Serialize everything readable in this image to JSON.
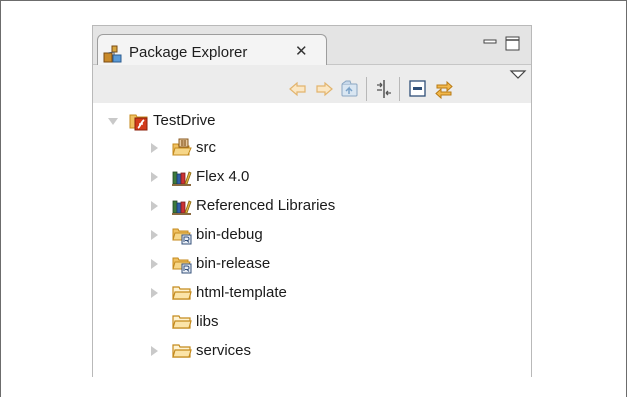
{
  "view": {
    "title": "Package Explorer",
    "close_glyph": "✕",
    "icon": "package-explorer-icon"
  },
  "toolbar": {
    "buttons": [
      "back-icon",
      "forward-icon",
      "up-icon",
      "collapse-all-icon",
      "focus-icon",
      "link-with-editor-icon",
      "view-menu-icon"
    ]
  },
  "tree": {
    "project": {
      "label": "TestDrive",
      "icon": "flex-project-icon",
      "expanded": true
    },
    "items": [
      {
        "label": "src",
        "icon": "source-folder-icon",
        "has_children": true
      },
      {
        "label": "Flex 4.0",
        "icon": "library-icon",
        "has_children": true
      },
      {
        "label": "Referenced Libraries",
        "icon": "library-icon",
        "has_children": true
      },
      {
        "label": "bin-debug",
        "icon": "output-folder-icon",
        "has_children": true
      },
      {
        "label": "bin-release",
        "icon": "output-folder-icon",
        "has_children": true
      },
      {
        "label": "html-template",
        "icon": "folder-icon",
        "has_children": true
      },
      {
        "label": "libs",
        "icon": "folder-icon",
        "has_children": false
      },
      {
        "label": "services",
        "icon": "folder-icon",
        "has_children": true
      }
    ]
  },
  "colors": {
    "folder": "#f0c060",
    "folder_edge": "#c48a1c",
    "arrow_tint": "#f1d7a8",
    "flex_red": "#d23a1a"
  }
}
